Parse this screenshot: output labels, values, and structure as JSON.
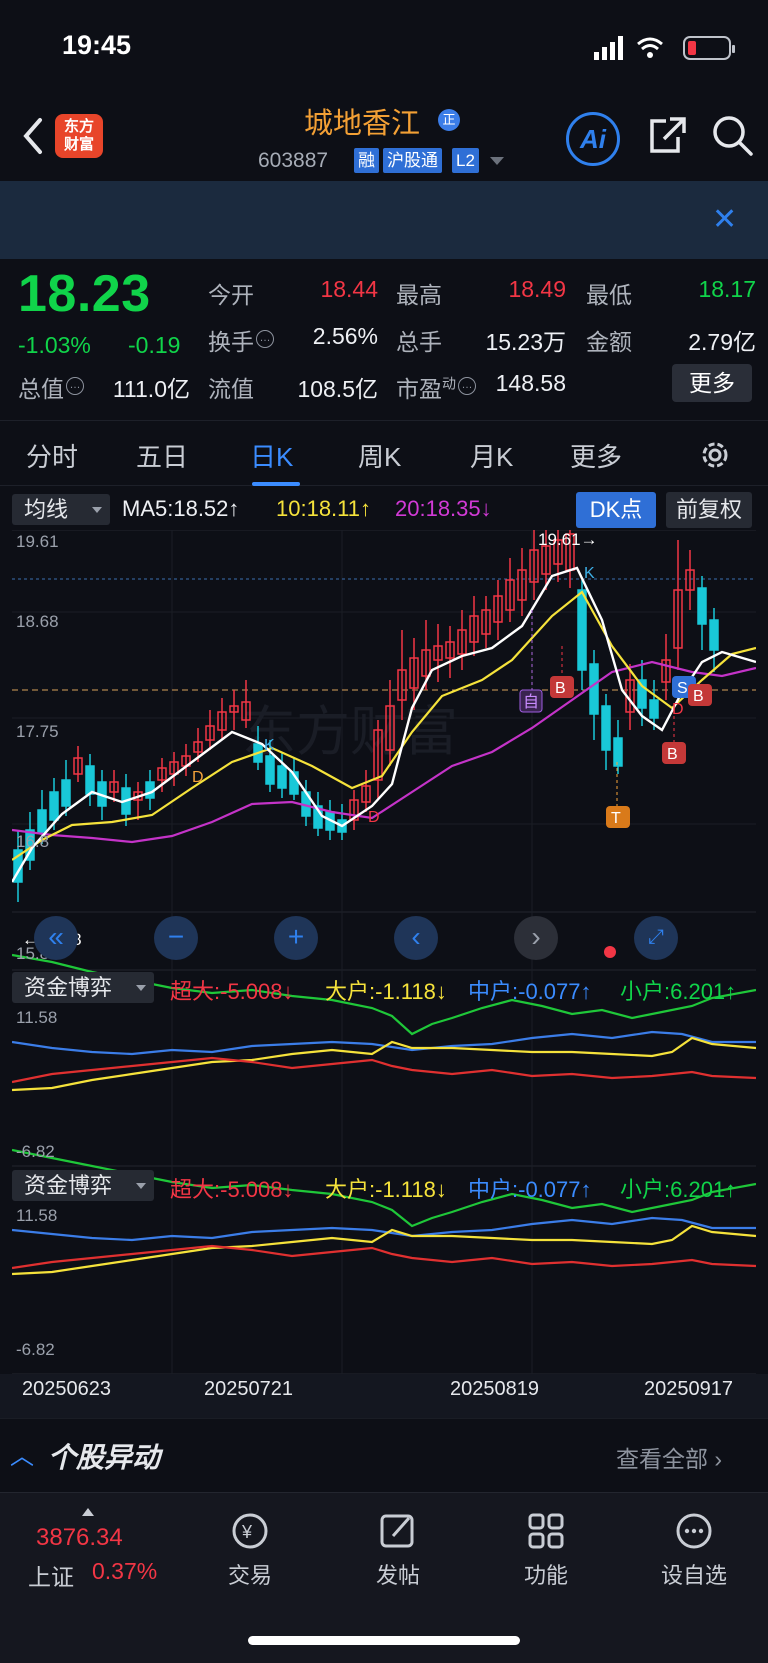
{
  "status": {
    "time": "19:45"
  },
  "header": {
    "logo_text": "东方财富",
    "stock_name": "城地香江",
    "stock_badge": "正",
    "stock_code": "603887",
    "tags": [
      "融",
      "沪股通",
      "L2"
    ],
    "ai_label": "Ai"
  },
  "quote": {
    "price": "18.23",
    "change_pct": "-1.03%",
    "change_abs": "-0.19",
    "open_label": "今开",
    "open": "18.44",
    "high_label": "最高",
    "high": "18.49",
    "low_label": "最低",
    "low": "18.17",
    "turnover_label": "换手",
    "turnover": "2.56%",
    "volume_label": "总手",
    "volume": "15.23万",
    "amount_label": "金额",
    "amount": "2.79亿",
    "mktcap_label": "总值",
    "mktcap": "111.0亿",
    "float_label": "流值",
    "float": "108.5亿",
    "pe_label": "市盈",
    "pe_sup": "动",
    "pe": "148.58",
    "more": "更多"
  },
  "tabs": [
    {
      "label": "分时"
    },
    {
      "label": "五日"
    },
    {
      "label": "日K"
    },
    {
      "label": "周K"
    },
    {
      "label": "月K"
    },
    {
      "label": "更多"
    }
  ],
  "chart_toolbar": {
    "indicator": "均线",
    "ma5": "MA5:18.52↑",
    "ma10": "10:18.11↑",
    "ma20": "20:18.35↓",
    "dk_button": "DK点",
    "adjust_button": "前复权"
  },
  "kline": {
    "y_top": "19.61",
    "y_mid1": "18.68",
    "y_mid2": "17.75",
    "y_low": "16.8",
    "y_bottom": "15.88",
    "high_label": "19.61→",
    "low_label": "←15.88",
    "markers": [
      "K",
      "D",
      "B",
      "S",
      "T",
      "自"
    ]
  },
  "fund1": {
    "indicator": "资金博弈",
    "super": "超大:-5.008↓",
    "large": "大户:-1.118↓",
    "mid": "中户:-0.077↑",
    "small": "小户:6.201↑",
    "y_top": "11.58",
    "y_bottom": "-6.82"
  },
  "fund2": {
    "indicator": "资金博弈",
    "super": "超大:-5.008↓",
    "large": "大户:-1.118↓",
    "mid": "中户:-0.077↑",
    "small": "小户:6.201↑",
    "y_top": "11.58",
    "y_bottom": "-6.82"
  },
  "dates": [
    "20250623",
    "20250721",
    "20250819",
    "20250917"
  ],
  "movement": {
    "title": "个股异动",
    "view_all": "查看全部"
  },
  "bottom_nav": {
    "index_value": "3876.34",
    "index_name": "上证",
    "index_pct": "0.37%",
    "items": [
      {
        "label": "交易"
      },
      {
        "label": "发帖"
      },
      {
        "label": "功能"
      },
      {
        "label": "设自选"
      }
    ]
  },
  "colors": {
    "up": "#f23645",
    "down": "#10d44a",
    "accent": "#3b8cff",
    "ma5": "#ffffff",
    "ma10": "#f5e23b",
    "ma20": "#d23ad6",
    "ma_purple": "#c433c8"
  }
}
